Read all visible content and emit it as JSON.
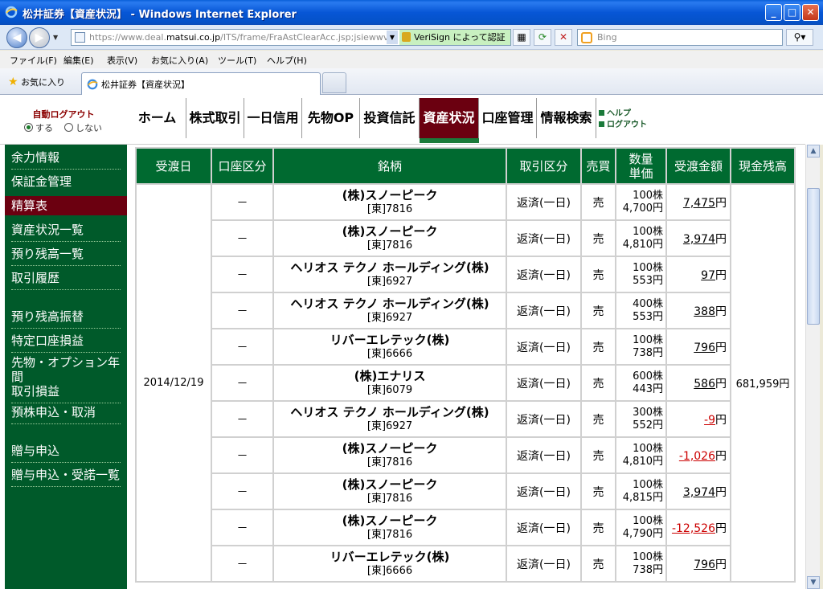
{
  "window": {
    "title": "松井証券【資産状況】 - Windows Internet Explorer",
    "minimize": "_",
    "maximize": "□",
    "close": "✕"
  },
  "addressbar": {
    "url_prefix": "https://www.deal.",
    "url_domain": "matsui.co.jp",
    "url_rest": "/ITS/frame/FraAstClearAcc.jsp;jsiewwv04:",
    "cert_text": "VeriSign によって認証",
    "search_placeholder": "Bing"
  },
  "menu": [
    "ファイル(F)",
    "編集(E)",
    "表示(V)",
    "お気に入り(A)",
    "ツール(T)",
    "ヘルプ(H)"
  ],
  "favorites": {
    "label": "お気に入り",
    "tab_title": "松井証券【資産状況】"
  },
  "autologout": {
    "label": "自動ログアウト",
    "on": "する",
    "off": "しない",
    "selected": "on"
  },
  "topnav": [
    "ホーム",
    "株式取引",
    "一日信用",
    "先物OP",
    "投資信託",
    "資産状況",
    "口座管理",
    "情報検索"
  ],
  "topnav_active": "資産状況",
  "help_links": [
    "ヘルプ",
    "ログアウト"
  ],
  "sidebar": [
    "余力情報",
    "保証金管理",
    "精算表",
    "資産状況一覧",
    "預り残高一覧",
    "取引履歴",
    "預り残高振替",
    "特定口座損益",
    "先物・オプション年間",
    "取引損益",
    "預株申込・取消",
    "贈与申込",
    "贈与申込・受諾一覧"
  ],
  "sidebar_active": "精算表",
  "table": {
    "headers": [
      "受渡日",
      "口座区分",
      "銘柄",
      "取引区分",
      "売買",
      "数量",
      "単価",
      "受渡金額",
      "現金残高"
    ],
    "date": "2014/12/19",
    "cash_balance": "681,959円",
    "rows": [
      {
        "account": "－",
        "name": "(株)スノーピーク",
        "market": "[東]",
        "code": "7816",
        "type": "返済(一日)",
        "side": "売",
        "qty": "100株",
        "price": "4,700円",
        "amount": "7,475",
        "yen": "円",
        "negative": false
      },
      {
        "account": "－",
        "name": "(株)スノーピーク",
        "market": "[東]",
        "code": "7816",
        "type": "返済(一日)",
        "side": "売",
        "qty": "100株",
        "price": "4,810円",
        "amount": "3,974",
        "yen": "円",
        "negative": false
      },
      {
        "account": "－",
        "name": "ヘリオス テクノ ホールディング(株)",
        "market": "[東]",
        "code": "6927",
        "type": "返済(一日)",
        "side": "売",
        "qty": "100株",
        "price": "553円",
        "amount": "97",
        "yen": "円",
        "negative": false
      },
      {
        "account": "－",
        "name": "ヘリオス テクノ ホールディング(株)",
        "market": "[東]",
        "code": "6927",
        "type": "返済(一日)",
        "side": "売",
        "qty": "400株",
        "price": "553円",
        "amount": "388",
        "yen": "円",
        "negative": false
      },
      {
        "account": "－",
        "name": "リバーエレテック(株)",
        "market": "[東]",
        "code": "6666",
        "type": "返済(一日)",
        "side": "売",
        "qty": "100株",
        "price": "738円",
        "amount": "796",
        "yen": "円",
        "negative": false
      },
      {
        "account": "－",
        "name": "(株)エナリス",
        "market": "[東]",
        "code": "6079",
        "type": "返済(一日)",
        "side": "売",
        "qty": "600株",
        "price": "443円",
        "amount": "586",
        "yen": "円",
        "negative": false
      },
      {
        "account": "－",
        "name": "ヘリオス テクノ ホールディング(株)",
        "market": "[東]",
        "code": "6927",
        "type": "返済(一日)",
        "side": "売",
        "qty": "300株",
        "price": "552円",
        "amount": "-9",
        "yen": "円",
        "negative": true
      },
      {
        "account": "－",
        "name": "(株)スノーピーク",
        "market": "[東]",
        "code": "7816",
        "type": "返済(一日)",
        "side": "売",
        "qty": "100株",
        "price": "4,810円",
        "amount": "-1,026",
        "yen": "円",
        "negative": true
      },
      {
        "account": "－",
        "name": "(株)スノーピーク",
        "market": "[東]",
        "code": "7816",
        "type": "返済(一日)",
        "side": "売",
        "qty": "100株",
        "price": "4,815円",
        "amount": "3,974",
        "yen": "円",
        "negative": false
      },
      {
        "account": "－",
        "name": "(株)スノーピーク",
        "market": "[東]",
        "code": "7816",
        "type": "返済(一日)",
        "side": "売",
        "qty": "100株",
        "price": "4,790円",
        "amount": "-12,526",
        "yen": "円",
        "negative": true
      },
      {
        "account": "－",
        "name": "リバーエレテック(株)",
        "market": "[東]",
        "code": "6666",
        "type": "返済(一日)",
        "side": "売",
        "qty": "100株",
        "price": "738円",
        "amount": "796",
        "yen": "円",
        "negative": false
      }
    ]
  }
}
